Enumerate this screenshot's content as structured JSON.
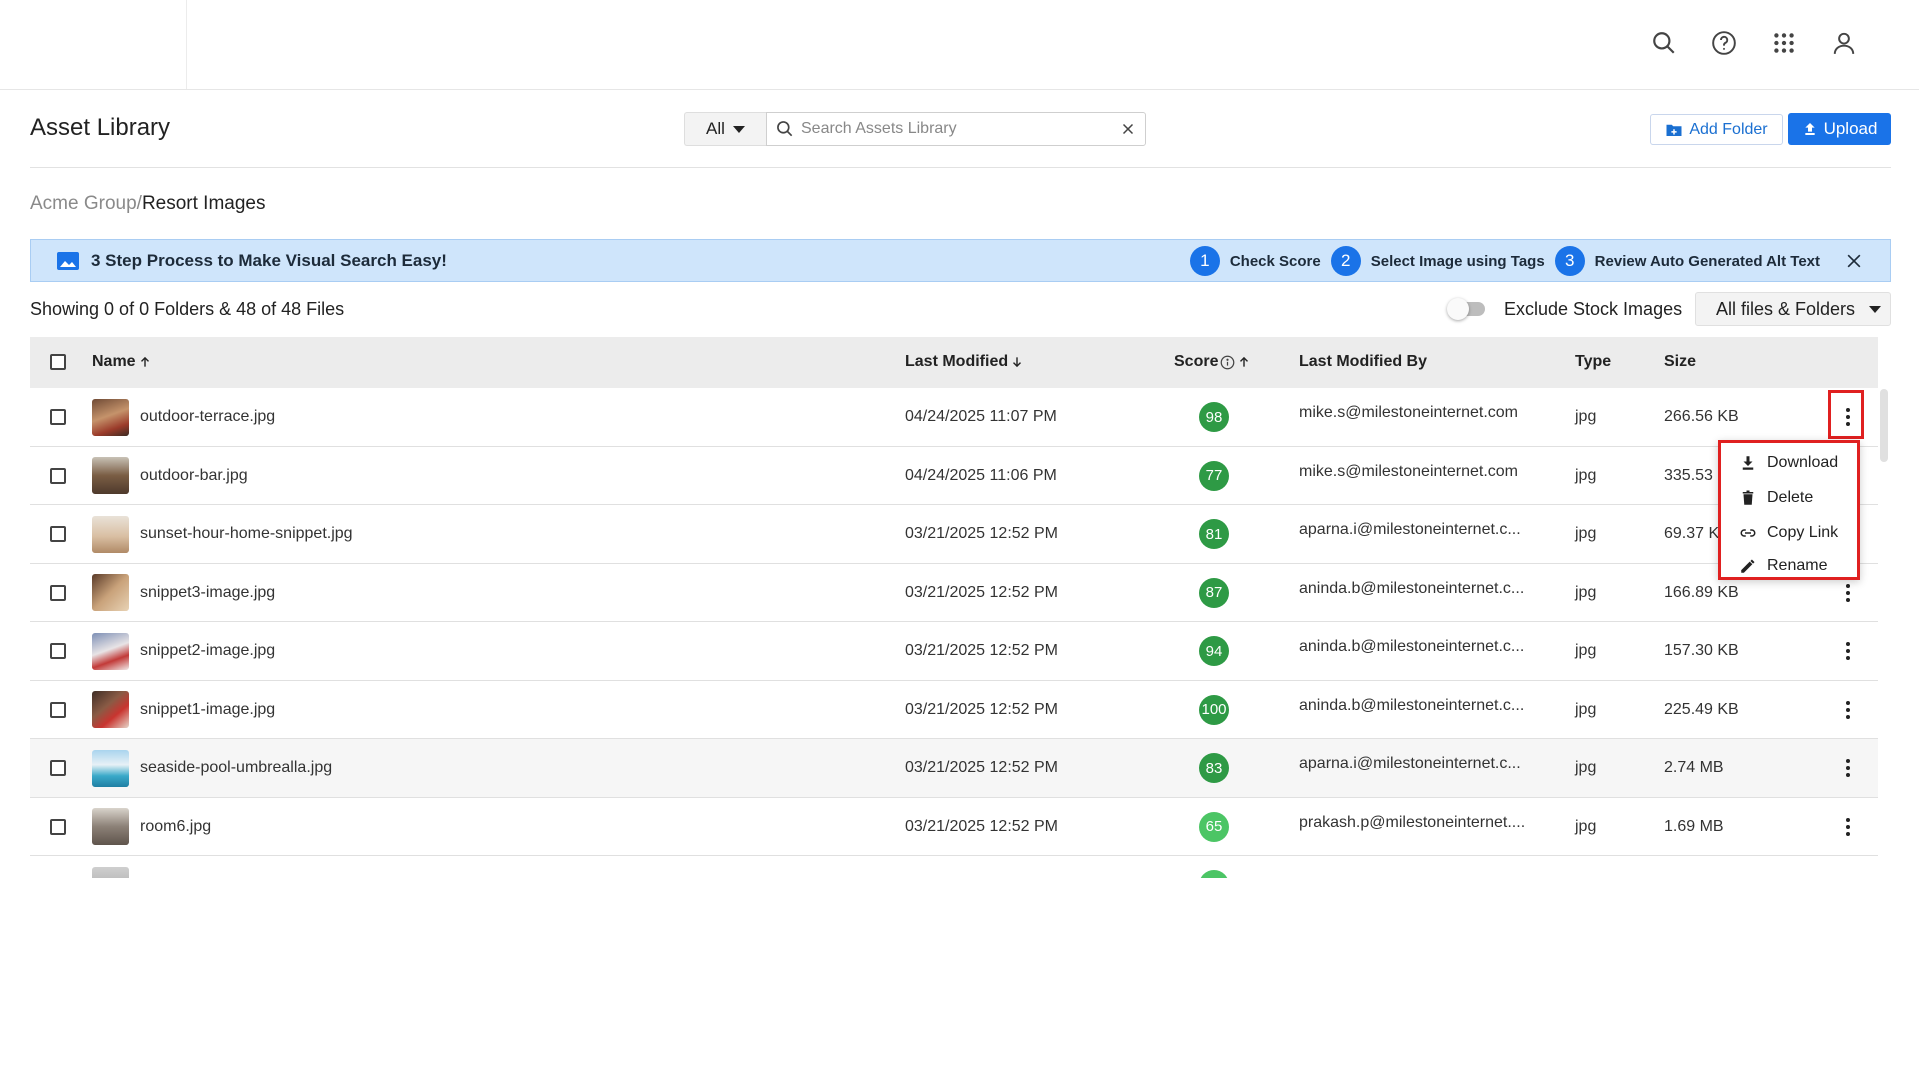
{
  "header": {
    "icons": [
      "search-icon",
      "help-icon",
      "apps-grid-icon",
      "user-icon"
    ]
  },
  "page": {
    "title": "Asset Library"
  },
  "search": {
    "filter_value": "All",
    "placeholder": "Search Assets Library"
  },
  "actions": {
    "add_folder": "Add Folder",
    "upload": "Upload"
  },
  "breadcrumb": {
    "root": "Acme Group/",
    "current": "Resort Images"
  },
  "banner": {
    "title": "3 Step Process to Make Visual Search Easy!",
    "steps": [
      {
        "num": "1",
        "label": "Check Score"
      },
      {
        "num": "2",
        "label": "Select Image using Tags"
      },
      {
        "num": "3",
        "label": "Review Auto Generated Alt Text"
      }
    ]
  },
  "summary": {
    "text": "Showing 0 of 0 Folders & 48 of 48 Files",
    "toggle_label": "Exclude Stock Images",
    "toggle_on": false,
    "view_select": "All files & Folders"
  },
  "table": {
    "headers": {
      "name": "Name",
      "last_modified": "Last Modified",
      "score": "Score",
      "last_modified_by": "Last Modified By",
      "type": "Type",
      "size": "Size"
    },
    "rows": [
      {
        "name": "outdoor-terrace.jpg",
        "date": "04/24/2025 11:07 PM",
        "score": "98",
        "by": "mike.s@milestoneinternet.com",
        "type": "jpg",
        "size": "266.56 KB"
      },
      {
        "name": "outdoor-bar.jpg",
        "date": "04/24/2025 11:06 PM",
        "score": "77",
        "by": "mike.s@milestoneinternet.com",
        "type": "jpg",
        "size": "335.53"
      },
      {
        "name": "sunset-hour-home-snippet.jpg",
        "date": "03/21/2025 12:52 PM",
        "score": "81",
        "by": "aparna.i@milestoneinternet.c...",
        "type": "jpg",
        "size": "69.37 K"
      },
      {
        "name": "snippet3-image.jpg",
        "date": "03/21/2025 12:52 PM",
        "score": "87",
        "by": "aninda.b@milestoneinternet.c...",
        "type": "jpg",
        "size": "166.89 KB"
      },
      {
        "name": "snippet2-image.jpg",
        "date": "03/21/2025 12:52 PM",
        "score": "94",
        "by": "aninda.b@milestoneinternet.c...",
        "type": "jpg",
        "size": "157.30 KB"
      },
      {
        "name": "snippet1-image.jpg",
        "date": "03/21/2025 12:52 PM",
        "score": "100",
        "by": "aninda.b@milestoneinternet.c...",
        "type": "jpg",
        "size": "225.49 KB"
      },
      {
        "name": "seaside-pool-umbrealla.jpg",
        "date": "03/21/2025 12:52 PM",
        "score": "83",
        "by": "aparna.i@milestoneinternet.c...",
        "type": "jpg",
        "size": "2.74 MB"
      },
      {
        "name": "room6.jpg",
        "date": "03/21/2025 12:52 PM",
        "score": "65",
        "by": "prakash.p@milestoneinternet....",
        "type": "jpg",
        "size": "1.69 MB"
      }
    ]
  },
  "context_menu": {
    "items": [
      {
        "label": "Download",
        "icon": "download-icon"
      },
      {
        "label": "Delete",
        "icon": "trash-icon"
      },
      {
        "label": "Copy Link",
        "icon": "link-icon"
      },
      {
        "label": "Rename",
        "icon": "pencil-icon"
      }
    ]
  },
  "colors": {
    "accent": "#1a73e8",
    "score_dark": "#2e9a45",
    "score_light": "#4cc565",
    "banner_bg": "#cfe5fb",
    "highlight": "#e02020"
  }
}
